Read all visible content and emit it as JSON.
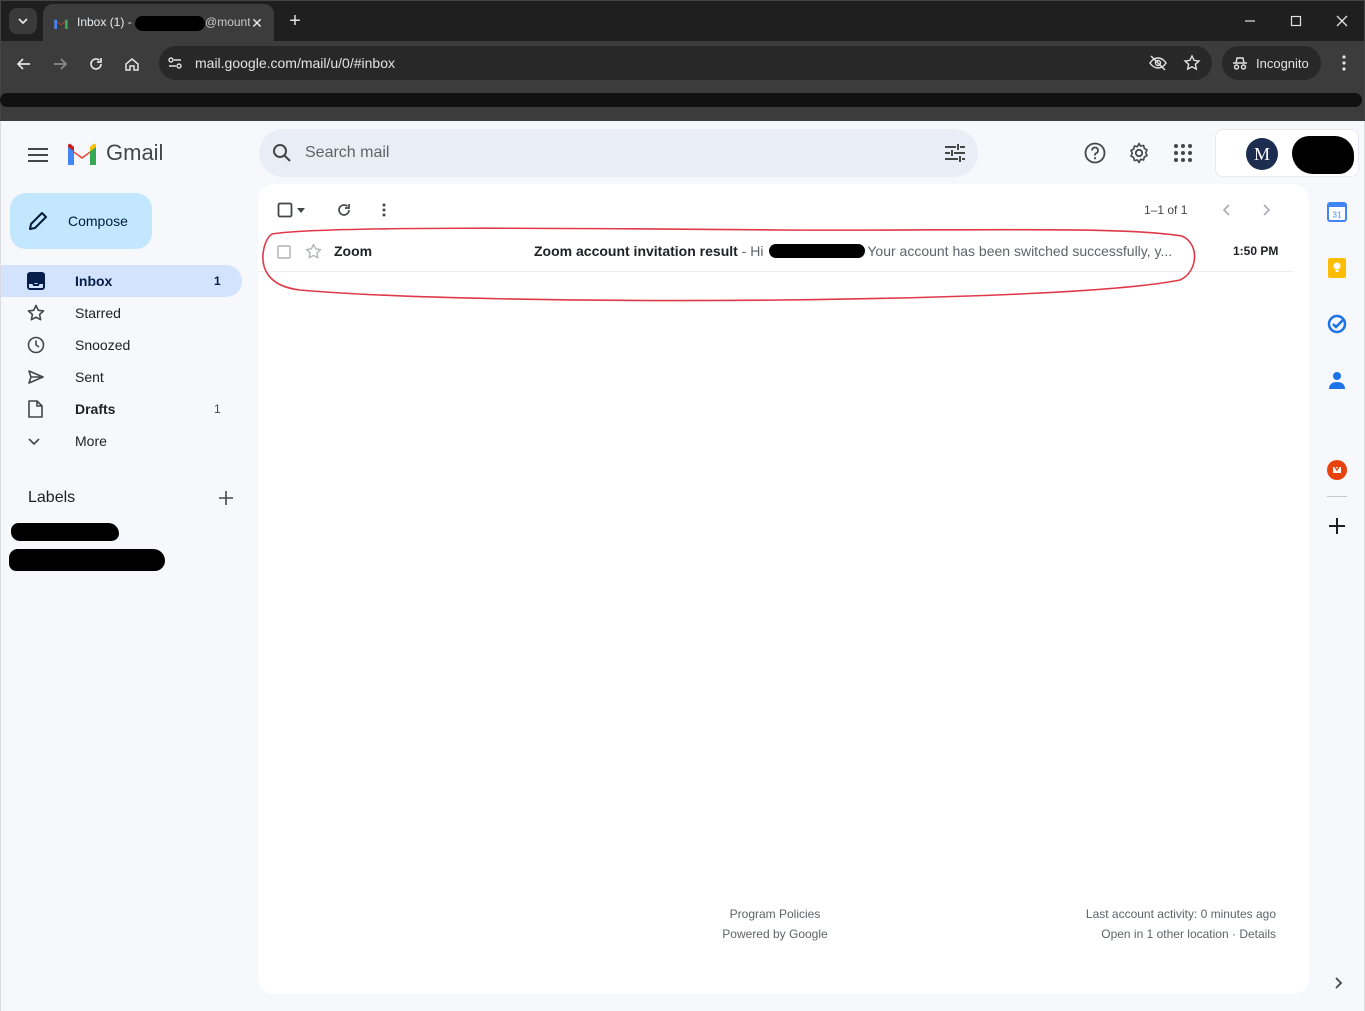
{
  "browser": {
    "tab_title_prefix": "Inbox (1) - ",
    "tab_title_suffix": "@mount",
    "url": "mail.google.com/mail/u/0/#inbox",
    "incognito_label": "Incognito"
  },
  "header": {
    "app_name": "Gmail",
    "search_placeholder": "Search mail",
    "avatar_initial": "M"
  },
  "sidebar": {
    "compose_label": "Compose",
    "items": [
      {
        "label": "Inbox",
        "count": "1",
        "icon": "inbox-icon"
      },
      {
        "label": "Starred",
        "count": "",
        "icon": "star-icon"
      },
      {
        "label": "Snoozed",
        "count": "",
        "icon": "clock-icon"
      },
      {
        "label": "Sent",
        "count": "",
        "icon": "send-icon"
      },
      {
        "label": "Drafts",
        "count": "1",
        "icon": "draft-icon"
      },
      {
        "label": "More",
        "count": "",
        "icon": "chevron-down-icon"
      }
    ],
    "labels_heading": "Labels"
  },
  "toolbar": {
    "pagination": "1–1 of 1"
  },
  "emails": [
    {
      "sender": "Zoom",
      "subject": "Zoom account invitation result",
      "snippet_prefix": " - Hi ",
      "snippet": "Your account has been switched successfully, y...",
      "time": "1:50 PM"
    }
  ],
  "footer": {
    "program_policies": "Program Policies",
    "powered_by": "Powered by Google",
    "last_activity": "Last account activity: 0 minutes ago",
    "other_location": "Open in 1 other location · Details"
  },
  "colors": {
    "accent": "#c2e7ff",
    "active_nav": "#d3e3fd",
    "annotation": "#e03a4a"
  }
}
